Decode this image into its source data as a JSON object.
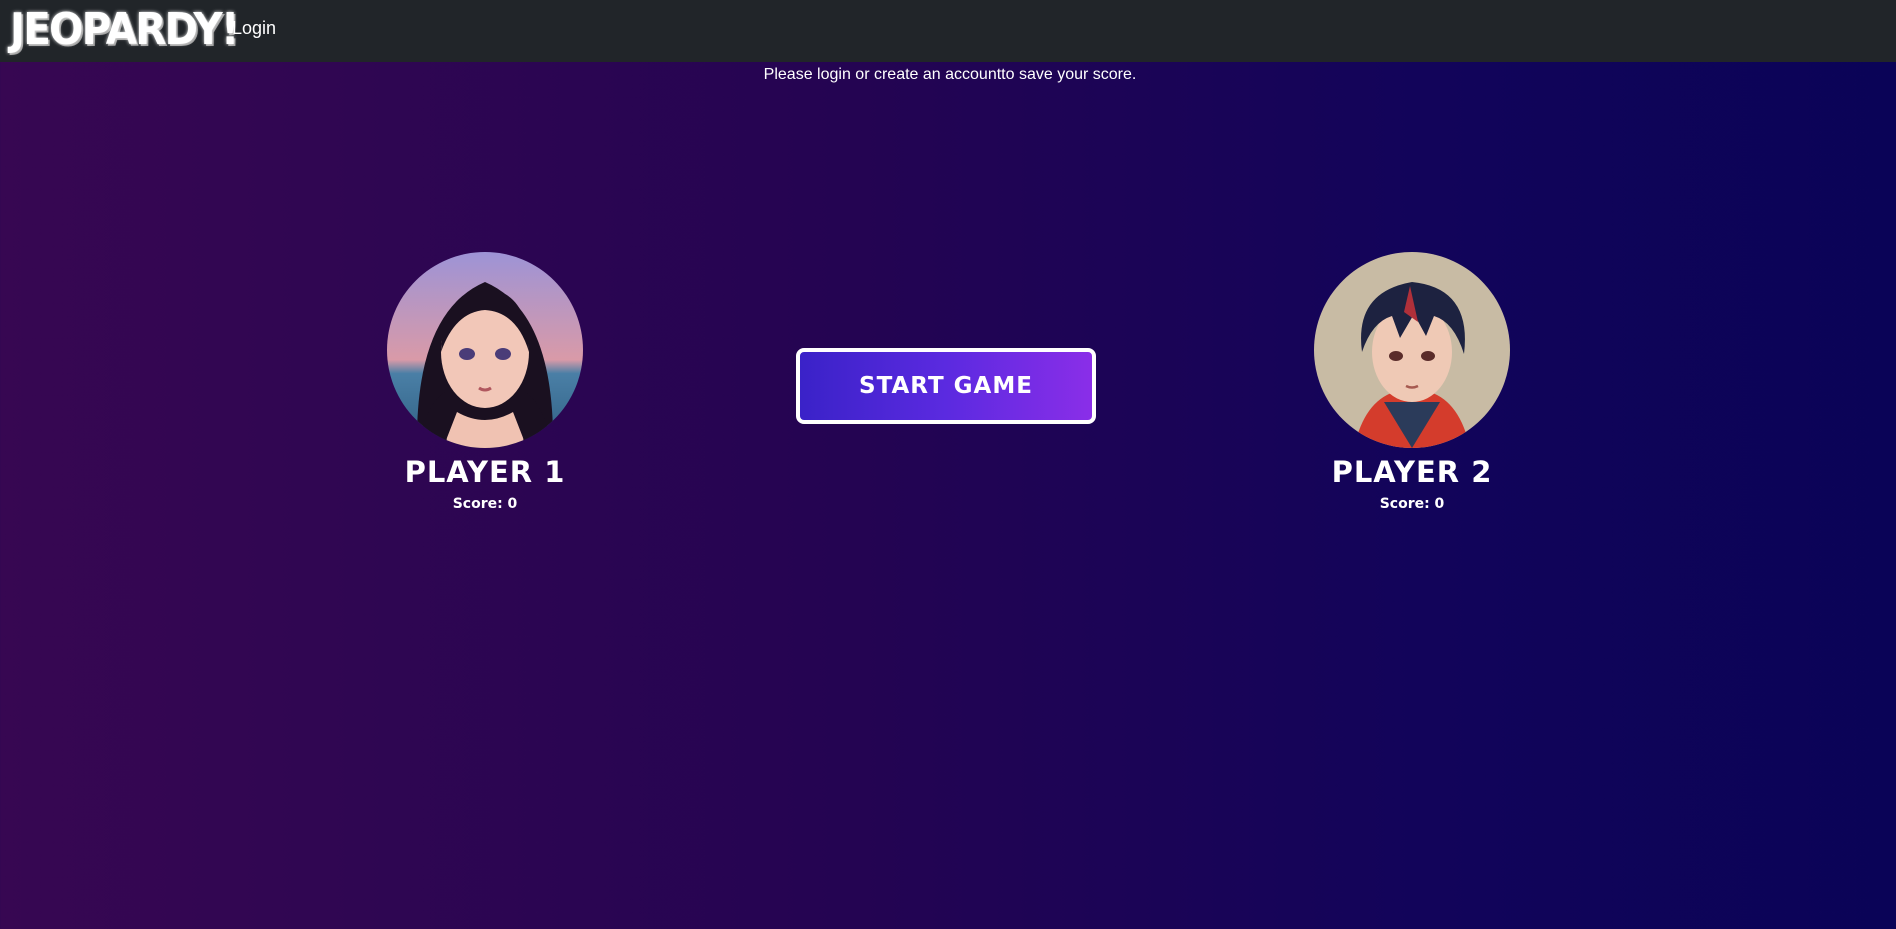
{
  "navbar": {
    "brand": "JEOPARDY!",
    "login_link": "Login"
  },
  "notice": "Please login or create an accountto save your score.",
  "players": [
    {
      "name": "PLAYER 1",
      "score_text": "Score: 0"
    },
    {
      "name": "PLAYER 2",
      "score_text": "Score: 0"
    }
  ],
  "start_button": "START GAME",
  "colors": {
    "navbar_bg": "#212529",
    "bg_left": "#370752",
    "bg_right": "#0a0357",
    "button_left": "#3a22c8",
    "button_right": "#8a2ee8"
  }
}
